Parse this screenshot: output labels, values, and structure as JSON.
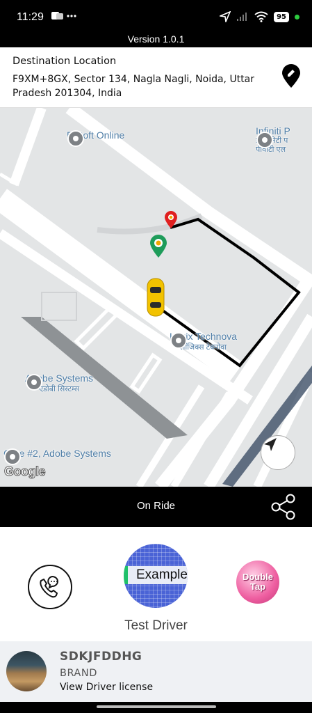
{
  "status_bar": {
    "time": "11:29",
    "left_icons": "teams-icon, more-dots",
    "battery": "95"
  },
  "version": "Version 1.0.1",
  "destination": {
    "label": "Destination Location",
    "address": "F9XM+8GX, Sector 134, Nagla Nagli, Noida, Uttar Pradesh 201304, India"
  },
  "map": {
    "pois": [
      {
        "name": "E-Soft Online",
        "sub": ""
      },
      {
        "name": "Infiniti P",
        "sub": "इन्फिनिटी प पीवीटी एल"
      },
      {
        "name": "Logix Technova",
        "sub": "लॉजिक्स टेक्नोवा"
      },
      {
        "name": "Adobe Systems",
        "sub": "एडोबी सिस्टम्स"
      },
      {
        "name": "Gate #2, Adobe Systems",
        "sub": ""
      }
    ],
    "logo": "Google",
    "route_color": "#000000",
    "pickup_pin_color": "#e02020",
    "drop_pin_color": "#1e9c5a",
    "car_color": "#f2c200"
  },
  "ride": {
    "status": "On Ride"
  },
  "driver": {
    "photo_text": "Example",
    "double_tap_label": "Double Tap",
    "name": "Test Driver"
  },
  "vehicle": {
    "plate": "SDKJFDDHG",
    "brand": "BRAND",
    "license_link": "View Driver license"
  }
}
